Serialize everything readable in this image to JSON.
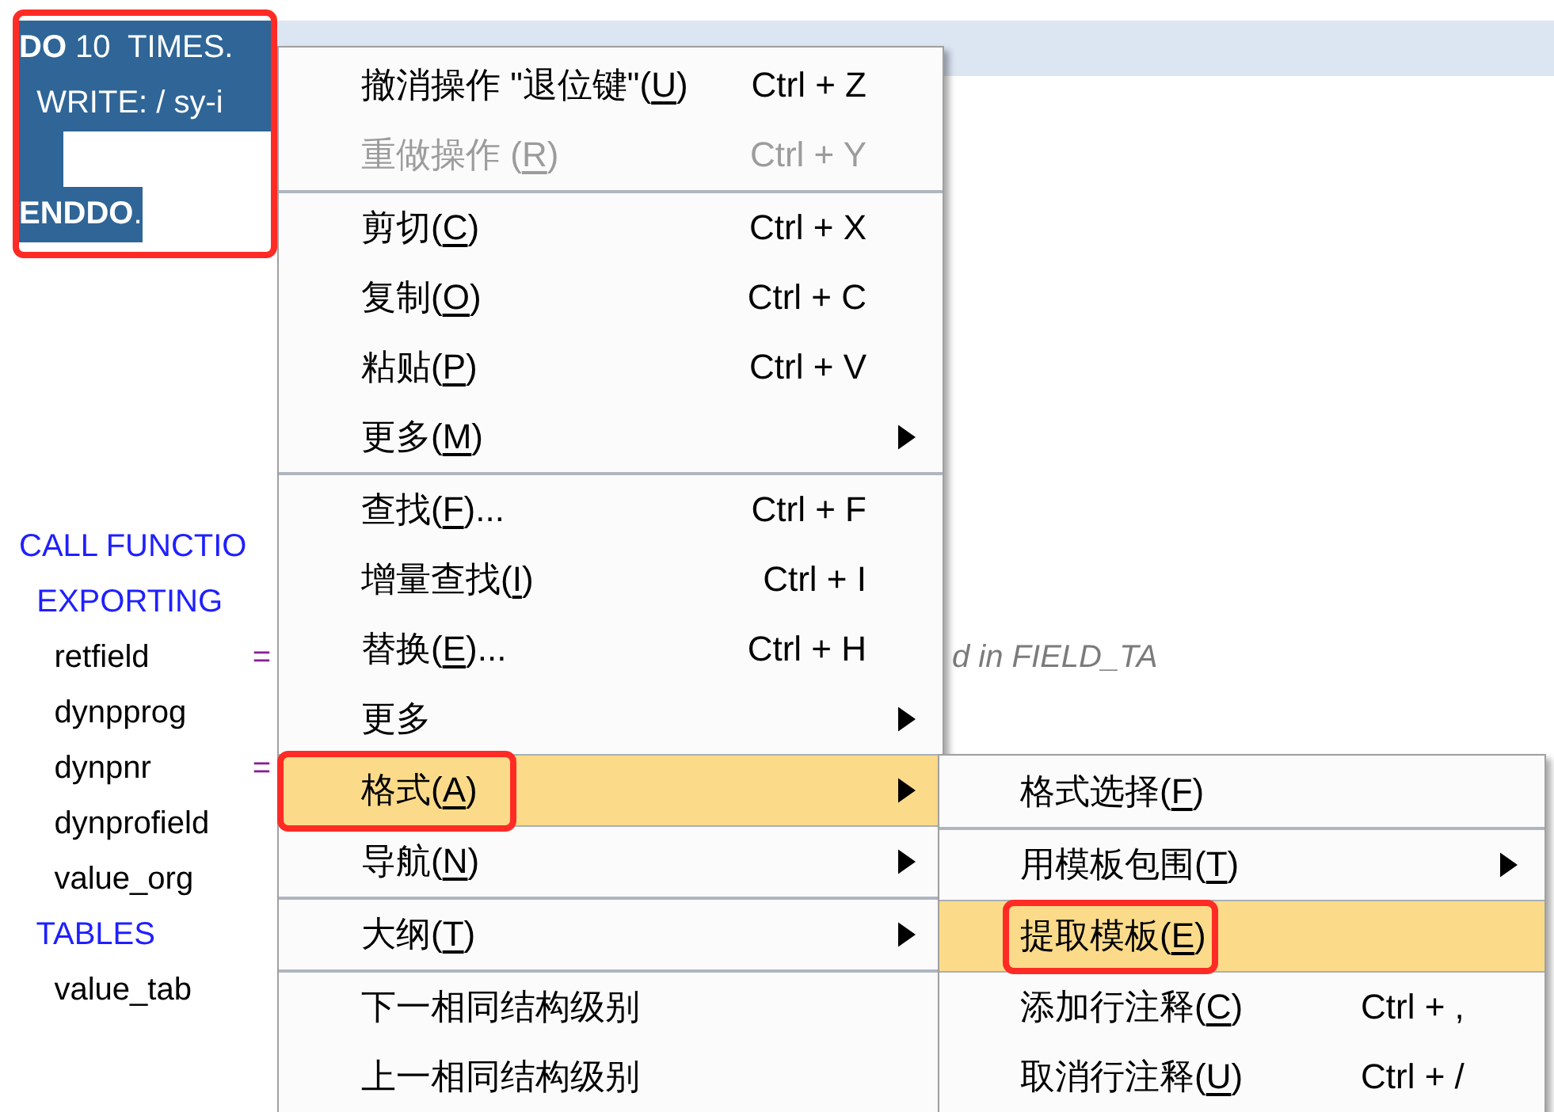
{
  "editor": {
    "selection_framed": true,
    "blocks": [
      {
        "lines": [
          {
            "current": true,
            "selected": true,
            "selected_to_edge": true,
            "tokens": [
              {
                "text": "DO",
                "kind": "block_keyword"
              },
              {
                "text": " 10  TIMES.",
                "kind": "text"
              }
            ]
          },
          {
            "current": false,
            "selected": true,
            "selected_to_edge": true,
            "tokens": [
              {
                "text": "  WRITE: / sy-i",
                "kind": "text"
              }
            ]
          },
          {
            "current": false,
            "selected": true,
            "selected_to_edge": false
          },
          {
            "current": false,
            "selected": true,
            "selected_to_edge": false,
            "tokens": [
              {
                "text": "ENDDO",
                "kind": "block_keyword"
              },
              {
                "text": ".",
                "kind": "text"
              }
            ]
          }
        ]
      },
      {
        "lines": [
          {
            "current": false,
            "selected": false,
            "tokens": [
              {
                "text": "CALL FUNCTIO",
                "kind": "keyword"
              }
            ]
          },
          {
            "current": false,
            "selected": false,
            "tokens": [
              {
                "text": "  EXPORTING",
                "kind": "keyword"
              }
            ]
          },
          {
            "current": false,
            "selected": false,
            "tokens": [
              {
                "text": "    retfield",
                "kind": "text"
              },
              {
                "text": "=",
                "kind": "operator"
              },
              {
                "text": "d in FIELD_TA",
                "kind": "comment"
              }
            ]
          },
          {
            "current": false,
            "selected": false,
            "tokens": [
              {
                "text": "    dynpprog",
                "kind": "text"
              }
            ]
          },
          {
            "current": false,
            "selected": false,
            "tokens": [
              {
                "text": "    dynpnr",
                "kind": "text"
              },
              {
                "text": "=",
                "kind": "operator"
              }
            ]
          },
          {
            "current": false,
            "selected": false,
            "tokens": [
              {
                "text": "    dynprofield",
                "kind": "text"
              }
            ]
          },
          {
            "current": false,
            "selected": false,
            "tokens": [
              {
                "text": "    value_org",
                "kind": "text"
              }
            ]
          },
          {
            "current": false,
            "selected": false,
            "tokens": [
              {
                "text": "  TABLES",
                "kind": "keyword"
              }
            ]
          },
          {
            "current": false,
            "selected": false,
            "tokens": [
              {
                "text": "    value_tab",
                "kind": "text"
              }
            ]
          }
        ]
      }
    ]
  },
  "context_menu": {
    "groups": [
      {
        "items": [
          {
            "kind": "command",
            "label": "撤消操作 \"退位键\"(",
            "access_key": "U",
            "label_end": ")",
            "shortcut": "Ctrl + Z",
            "disabled": false,
            "highlighted": false,
            "framed": false
          },
          {
            "kind": "command",
            "label": "重做操作 (",
            "access_key": "R",
            "label_end": ")",
            "shortcut": "Ctrl + Y",
            "disabled": true,
            "highlighted": false,
            "framed": false
          }
        ]
      },
      {
        "items": [
          {
            "kind": "command",
            "label": "剪切(",
            "access_key": "C",
            "label_end": ")",
            "shortcut": "Ctrl + X",
            "disabled": false,
            "highlighted": false,
            "framed": false
          },
          {
            "kind": "command",
            "label": "复制(",
            "access_key": "O",
            "label_end": ")",
            "shortcut": "Ctrl + C",
            "disabled": false,
            "highlighted": false,
            "framed": false
          },
          {
            "kind": "command",
            "label": "粘贴(",
            "access_key": "P",
            "label_end": ")",
            "shortcut": "Ctrl + V",
            "disabled": false,
            "highlighted": false,
            "framed": false
          },
          {
            "kind": "submenu",
            "label": "更多(",
            "access_key": "M",
            "label_end": ")",
            "disabled": false,
            "highlighted": false,
            "framed": false
          }
        ]
      },
      {
        "items": [
          {
            "kind": "command",
            "label": "查找(",
            "access_key": "F",
            "label_end": ")...",
            "shortcut": "Ctrl + F",
            "disabled": false,
            "highlighted": false,
            "framed": false
          },
          {
            "kind": "command",
            "label": "增量查找(",
            "access_key": "I",
            "label_end": ")",
            "shortcut": "Ctrl + I",
            "disabled": false,
            "highlighted": false,
            "framed": false
          },
          {
            "kind": "command",
            "label": "替换(",
            "access_key": "E",
            "label_end": ")...",
            "shortcut": "Ctrl + H",
            "disabled": false,
            "highlighted": false,
            "framed": false
          },
          {
            "kind": "submenu",
            "label": "更多",
            "disabled": false,
            "highlighted": false,
            "framed": false
          },
          {
            "kind": "submenu",
            "label": "格式(",
            "access_key": "A",
            "label_end": ")",
            "disabled": false,
            "highlighted": true,
            "framed": true
          },
          {
            "kind": "submenu",
            "label": "导航(",
            "access_key": "N",
            "label_end": ")",
            "disabled": false,
            "highlighted": false,
            "framed": false
          }
        ]
      },
      {
        "items": [
          {
            "kind": "submenu",
            "label": "大纲(",
            "access_key": "T",
            "label_end": ")",
            "disabled": false,
            "highlighted": false,
            "framed": false
          }
        ]
      },
      {
        "items": [
          {
            "kind": "command",
            "label": "下一相同结构级别",
            "disabled": false,
            "highlighted": false,
            "framed": false
          },
          {
            "kind": "command",
            "label": "上一相同结构级别",
            "disabled": false,
            "highlighted": false,
            "framed": false
          }
        ]
      }
    ]
  },
  "format_submenu": {
    "groups": [
      {
        "items": [
          {
            "kind": "command",
            "label": "格式选择(",
            "access_key": "F",
            "label_end": ")",
            "disabled": false,
            "highlighted": false,
            "framed": false
          }
        ]
      },
      {
        "items": [
          {
            "kind": "submenu",
            "label": "用模板包围(",
            "access_key": "T",
            "label_end": ")",
            "disabled": false,
            "highlighted": false,
            "framed": false
          },
          {
            "kind": "command",
            "label": "提取模板(",
            "access_key": "E",
            "label_end": ")",
            "disabled": false,
            "highlighted": true,
            "framed": true
          },
          {
            "kind": "command",
            "label": "添加行注释(",
            "access_key": "C",
            "label_end": ")",
            "shortcut": "Ctrl + ,",
            "disabled": false,
            "highlighted": false,
            "framed": false
          },
          {
            "kind": "command",
            "label": "取消行注释(",
            "access_key": "U",
            "label_end": ")",
            "shortcut": "Ctrl + /",
            "disabled": false,
            "highlighted": false,
            "framed": false
          }
        ]
      }
    ]
  }
}
